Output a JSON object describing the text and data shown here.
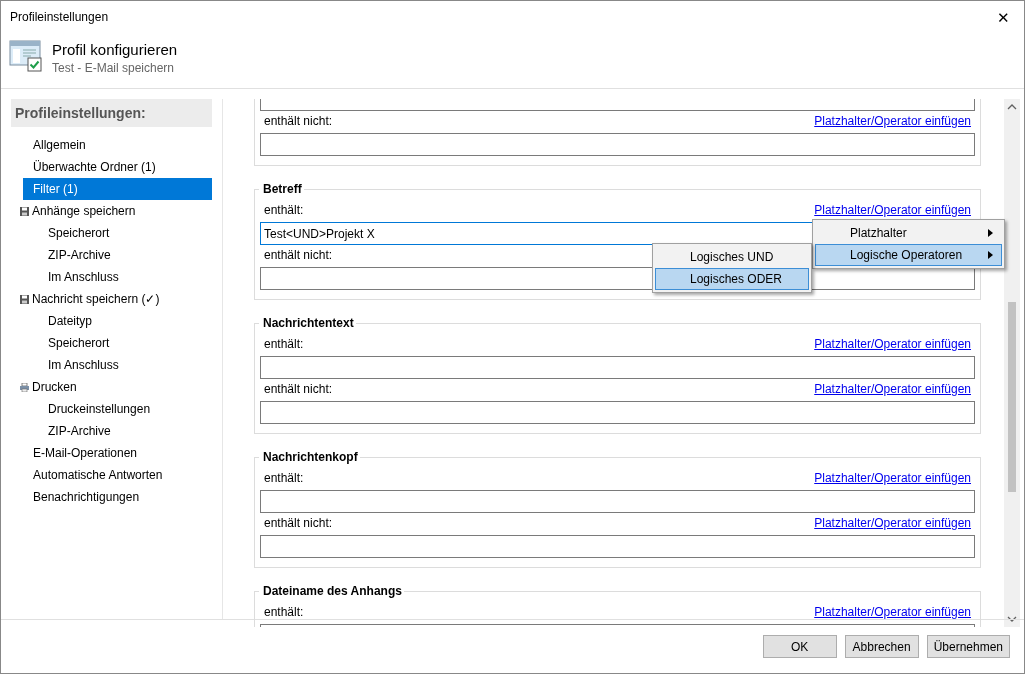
{
  "window": {
    "title": "Profileinstellungen",
    "close": "✕"
  },
  "header": {
    "title": "Profil konfigurieren",
    "subtitle": "Test - E-Mail speichern"
  },
  "sidebar": {
    "heading": "Profileinstellungen:",
    "items": [
      {
        "label": "Allgemein",
        "kind": "plain",
        "selected": false
      },
      {
        "label": "Überwachte Ordner (1)",
        "kind": "plain",
        "selected": false
      },
      {
        "label": "Filter (1)",
        "kind": "plain",
        "selected": true
      },
      {
        "label": "Anhänge speichern",
        "kind": "save",
        "selected": false,
        "children": [
          {
            "label": "Speicherort",
            "selected": false
          },
          {
            "label": "ZIP-Archive",
            "selected": false
          },
          {
            "label": "Im Anschluss",
            "selected": false
          }
        ]
      },
      {
        "label": "Nachricht speichern (✓)",
        "kind": "save",
        "selected": false,
        "children": [
          {
            "label": "Dateityp",
            "selected": false
          },
          {
            "label": "Speicherort",
            "selected": false
          },
          {
            "label": "Im Anschluss",
            "selected": false
          }
        ]
      },
      {
        "label": "Drucken",
        "kind": "print",
        "selected": false,
        "children": [
          {
            "label": "Druckeinstellungen",
            "selected": false
          },
          {
            "label": "ZIP-Archive",
            "selected": false
          }
        ]
      },
      {
        "label": "E-Mail-Operationen",
        "kind": "plain",
        "selected": false
      },
      {
        "label": "Automatische Antworten",
        "kind": "plain",
        "selected": false
      },
      {
        "label": "Benachrichtigungen",
        "kind": "plain",
        "selected": false
      }
    ]
  },
  "filter_groups": [
    {
      "kind": "cut_top",
      "rows": [
        {
          "label": "enthält nicht:",
          "link": "Platzhalter/Operator einfügen"
        }
      ]
    },
    {
      "kind": "full",
      "title": "Betreff",
      "rows": [
        {
          "label": "enthält:",
          "link": "Platzhalter/Operator einfügen",
          "value": "Test<UND>Projekt X",
          "focused": true
        },
        {
          "label": "enthält nicht:",
          "focused": false
        }
      ]
    },
    {
      "kind": "full",
      "title": "Nachrichtentext",
      "rows": [
        {
          "label": "enthält:",
          "link": "Platzhalter/Operator einfügen",
          "focused": false
        },
        {
          "label": "enthält nicht:",
          "link": "Platzhalter/Operator einfügen",
          "focused": false
        }
      ]
    },
    {
      "kind": "full",
      "title": "Nachrichtenkopf",
      "rows": [
        {
          "label": "enthält:",
          "link": "Platzhalter/Operator einfügen",
          "focused": false
        },
        {
          "label": "enthält nicht:",
          "link": "Platzhalter/Operator einfügen",
          "focused": false
        }
      ]
    },
    {
      "kind": "full",
      "title": "Dateiname des Anhangs",
      "rows": [
        {
          "label": "enthält:",
          "link": "Platzhalter/Operator einfügen",
          "focused": false
        }
      ]
    }
  ],
  "context_menu": {
    "items": [
      {
        "label": "Platzhalter",
        "selected": false
      },
      {
        "label": "Logische Operatoren",
        "selected": true
      }
    ],
    "submenu": {
      "items": [
        {
          "label": "Logisches UND",
          "selected": false
        },
        {
          "label": "Logisches ODER",
          "selected": true
        }
      ]
    }
  },
  "buttons": [
    "OK",
    "Abbrechen",
    "Übernehmen"
  ]
}
